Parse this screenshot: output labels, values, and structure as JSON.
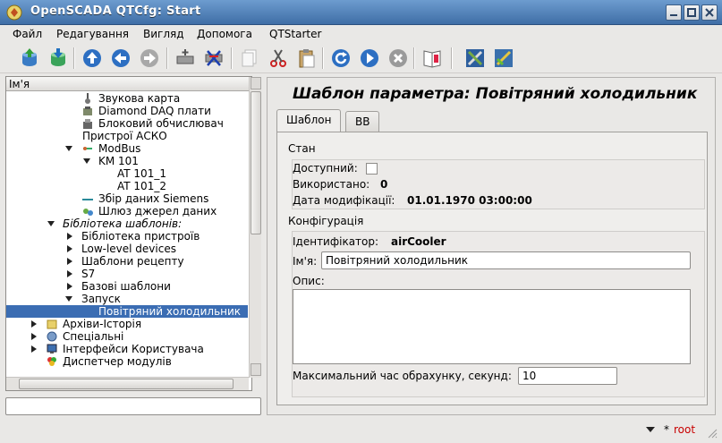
{
  "window": {
    "title": "OpenSCADA QTCfg: Start",
    "minimize_icon": "minimize-icon",
    "maximize_icon": "maximize-icon",
    "close_icon": "close-icon"
  },
  "menu": {
    "items": [
      {
        "label": "Файл",
        "underline": "Ф"
      },
      {
        "label": "Редагування",
        "underline": "Р"
      },
      {
        "label": "Вигляд",
        "underline": "В"
      },
      {
        "label": "Допомога",
        "underline": "Д"
      },
      {
        "label": "QTStarter",
        "underline": ""
      }
    ]
  },
  "toolbar": {
    "buttons": [
      "db-load-icon",
      "db-save-icon",
      "up-icon",
      "back-icon",
      "forward-icon",
      "item-add-icon",
      "item-delete-icon",
      "copy-icon",
      "cut-icon",
      "paste-icon",
      "reload-icon",
      "start-icon",
      "stop-icon",
      "manual-icon",
      "tools-icon",
      "tools2-icon"
    ]
  },
  "tree": {
    "header": "Ім'я",
    "rows": [
      {
        "label": "Звукова карта",
        "italic": false
      },
      {
        "label": "Diamond DAQ плати",
        "italic": false
      },
      {
        "label": "Блоковий обчислювач",
        "italic": false
      },
      {
        "label": "Пристрої АСКО",
        "italic": false
      },
      {
        "label": "ModBus",
        "italic": false
      },
      {
        "label": "KM 101",
        "italic": false
      },
      {
        "label": "AT 101_1",
        "italic": false
      },
      {
        "label": "AT 101_2",
        "italic": false
      },
      {
        "label": "Збір даних Siemens",
        "italic": false
      },
      {
        "label": "Шлюз джерел даних",
        "italic": false
      },
      {
        "label": "Бібліотека шаблонів:",
        "italic": true
      },
      {
        "label": "Бібліотека пристроїв",
        "italic": false
      },
      {
        "label": "Low-level devices",
        "italic": false
      },
      {
        "label": "Шаблони рецепту",
        "italic": false
      },
      {
        "label": "S7",
        "italic": false
      },
      {
        "label": "Базові шаблони",
        "italic": false
      },
      {
        "label": "Запуск",
        "italic": false
      },
      {
        "label": "Повітряний холодильник",
        "italic": false
      },
      {
        "label": "Архіви-Історія",
        "italic": false
      },
      {
        "label": "Спеціальні",
        "italic": false
      },
      {
        "label": "Інтерфейси Користувача",
        "italic": false
      },
      {
        "label": "Диспетчер модулів",
        "italic": false
      }
    ]
  },
  "command_input": {
    "value": ""
  },
  "page": {
    "title": "Шаблон параметра: Повітряний холодильник",
    "tabs": [
      "Шаблон",
      "ВВ"
    ],
    "state": {
      "section_title": "Стан",
      "enabled_label": "Доступний:",
      "enabled": false,
      "used_label": "Використано:",
      "used_value": "0",
      "modified_label": "Дата модифікації:",
      "modified_value": "01.01.1970 03:00:00"
    },
    "config": {
      "section_title": "Конфігурація",
      "id_label": "Ідентифікатор:",
      "id_value": "airCooler",
      "name_label": "Ім'я:",
      "name_value": "Повітряний холодильник",
      "desc_label": "Опис:",
      "desc_value": "",
      "calc_label": "Максимальний час обрахунку, секунд:",
      "calc_value": "10"
    }
  },
  "status": {
    "star": "*",
    "user": "root"
  },
  "colors": {
    "title_bar": "#4f80b8",
    "selection": "#3b6db3",
    "user_text": "#c80000"
  }
}
